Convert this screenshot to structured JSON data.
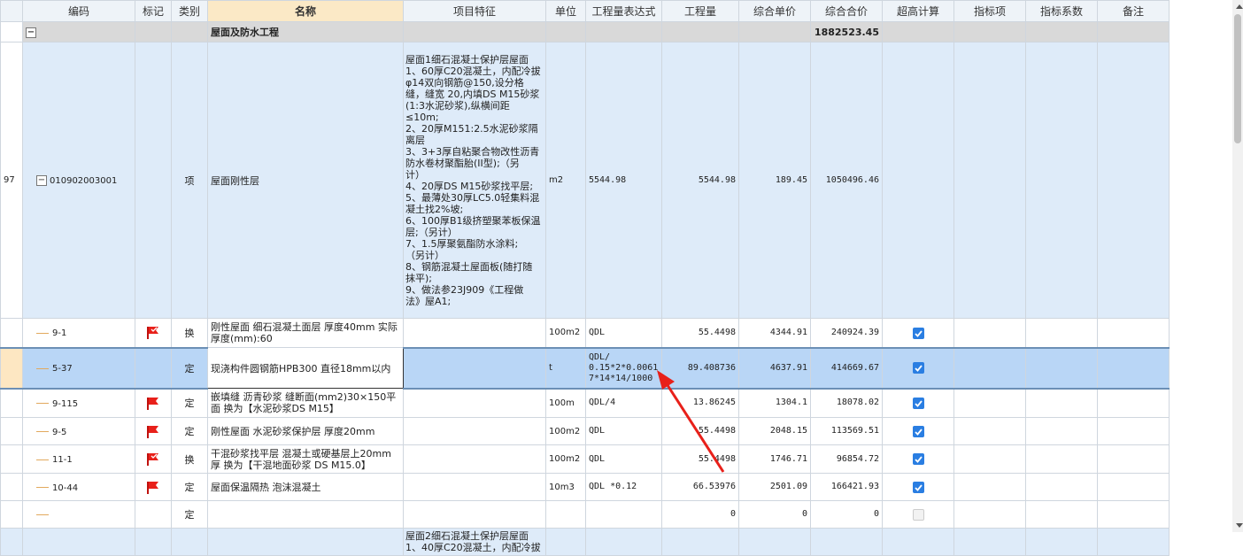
{
  "columns": [
    "编码",
    "标记",
    "类别",
    "名称",
    "项目特征",
    "单位",
    "工程量表达式",
    "工程量",
    "综合单价",
    "综合合价",
    "超高计算",
    "指标项",
    "指标系数",
    "备注"
  ],
  "icons": {
    "expand": "minus-box-icon",
    "flag": "red-flag-icon",
    "check": "checkbox-checked-icon",
    "arrow": "red-arrow-annotation"
  },
  "colors": {
    "selected_row": "#b9d6f6",
    "item_row": "#deebf9",
    "group_row": "#d9d9d9",
    "checkbox": "#2a7ee2",
    "flag": "#e8201a",
    "arrow": "#e8201a"
  },
  "group": {
    "expander": "−",
    "name": "屋面及防水工程",
    "total": "1882523.45"
  },
  "item": {
    "index": "97",
    "expander": "−",
    "code": "010902003001",
    "type": "项",
    "name": "屋面刚性层",
    "features": "屋面1细石混凝土保护层屋面\n1、60厚C20混凝土，内配冷拔\nφ14双向钢筋@150,设分格\n缝，缝宽 20,内填DS M15砂浆\n(1:3水泥砂浆),纵横间距\n≤10m;\n2、20厚M151:2.5水泥砂浆隔\n离层\n3、3+3厚自粘聚合物改性沥青\n防水卷材聚酯胎(II型);（另\n计）\n4、20厚DS M15砂浆找平层;\n5、最薄处30厚LC5.0轻集料混\n凝土找2%坡;\n6、100厚B1级挤塑聚苯板保温\n层;（另计）\n7、1.5厚聚氨酯防水涂料;\n（另计）\n8、钢筋混凝土屋面板(随打随\n抹平);\n9、做法参23J909《工程做\n法》屋A1;",
    "unit": "m2",
    "expr": "5544.98",
    "qty": "5544.98",
    "unit_price": "189.45",
    "total": "1050496.46"
  },
  "subrows": [
    {
      "code": "9-1",
      "flag": true,
      "type": "换",
      "name": "刚性屋面 细石混凝土面层 厚度40mm  实际厚度(mm):60",
      "unit": "100m2",
      "expr": "QDL",
      "qty": "55.4498",
      "unit_price": "4344.91",
      "total": "240924.39",
      "checked": true
    },
    {
      "code": "5-37",
      "flag": false,
      "type": "定",
      "name": "现浇构件圆钢筋HPB300 直径18mm以内",
      "unit": "t",
      "expr": "QDL/\n0.15*2*0.0061\n7*14*14/1000",
      "qty": "89.408736",
      "unit_price": "4637.91",
      "total": "414669.67",
      "checked": true
    },
    {
      "code": "9-115",
      "flag": true,
      "type": "定",
      "name": "嵌填缝 沥青砂浆 缝断面(mm2)30×150平面  换为【水泥砂浆DS M15】",
      "unit": "100m",
      "expr": "QDL/4",
      "qty": "13.86245",
      "unit_price": "1304.1",
      "total": "18078.02",
      "checked": true
    },
    {
      "code": "9-5",
      "flag": true,
      "type": "定",
      "name": "刚性屋面 水泥砂浆保护层 厚度20mm",
      "unit": "100m2",
      "expr": "QDL",
      "qty": "55.4498",
      "unit_price": "2048.15",
      "total": "113569.51",
      "checked": true
    },
    {
      "code": "11-1",
      "flag": true,
      "type": "换",
      "name": "干混砂浆找平层 混凝土或硬基层上20mm厚  换为【干混地面砂浆 DS M15.0】",
      "unit": "100m2",
      "expr": "QDL",
      "qty": "55.4498",
      "unit_price": "1746.71",
      "total": "96854.72",
      "checked": true
    },
    {
      "code": "10-44",
      "flag": true,
      "type": "定",
      "name": "屋面保温隔热 泡沫混凝土",
      "unit": "10m3",
      "expr": "QDL *0.12",
      "qty": "66.53976",
      "unit_price": "2501.09",
      "total": "166421.93",
      "checked": true
    },
    {
      "code": "",
      "flag": false,
      "type": "定",
      "name": "",
      "unit": "",
      "expr": "",
      "qty": "0",
      "unit_price": "0",
      "total": "0",
      "checked": false
    }
  ],
  "next_item": {
    "features": "屋面2细石混凝土保护层屋面\n1、40厚C20混凝土，内配冷拔"
  }
}
